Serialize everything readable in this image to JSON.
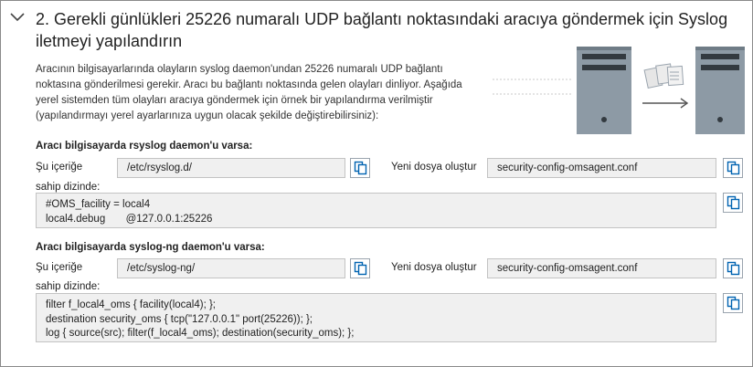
{
  "step": {
    "title": "2. Gerekli günlükleri 25226 numaralı UDP bağlantı noktasındaki aracıya göndermek için  Syslog iletmeyi yapılandırın",
    "description": "Aracının bilgisayarlarında olayların syslog daemon'undan 25226 numaralı UDP bağlantı noktasına gönderilmesi gerekir. Aracı bu bağlantı noktasında gelen olayları dinliyor. Aşağıda yerel sistemden tüm olayları aracıya göndermek için örnek bir yapılandırma verilmiştir (yapılandırmayı yerel ayarlarınıza uygun olacak şekilde değiştirebilirsiniz):"
  },
  "rsyslog": {
    "heading": "Aracı bilgisayarda rsyslog daemon'u varsa:",
    "dir_label": "Şu içeriğe",
    "dir_value": "/etc/rsyslog.d/",
    "file_label": "Yeni dosya oluştur",
    "file_value": "security-config-omsagent.conf",
    "content_label": "sahip dizinde:",
    "content": "#OMS_facility = local4\nlocal4.debug       @127.0.0.1:25226"
  },
  "syslogng": {
    "heading": "Aracı bilgisayarda syslog-ng daemon'u varsa:",
    "dir_label": "Şu içeriğe",
    "dir_value": "/etc/syslog-ng/",
    "file_label": "Yeni dosya oluştur",
    "file_value": "security-config-omsagent.conf",
    "content_label": "sahip dizinde:",
    "content": "filter f_local4_oms { facility(local4); };\ndestination security_oms { tcp(\"127.0.0.1\" port(25226)); };\nlog { source(src); filter(f_local4_oms); destination(security_oms); };"
  },
  "icons": {
    "collapse": "chevron-down-icon",
    "copy": "copy-icon",
    "illustration": "server-forwarding-illustration"
  },
  "colors": {
    "copy_icon": "#0063b1",
    "server": "#8d9aa5",
    "field_bg": "#f0f0f0"
  }
}
